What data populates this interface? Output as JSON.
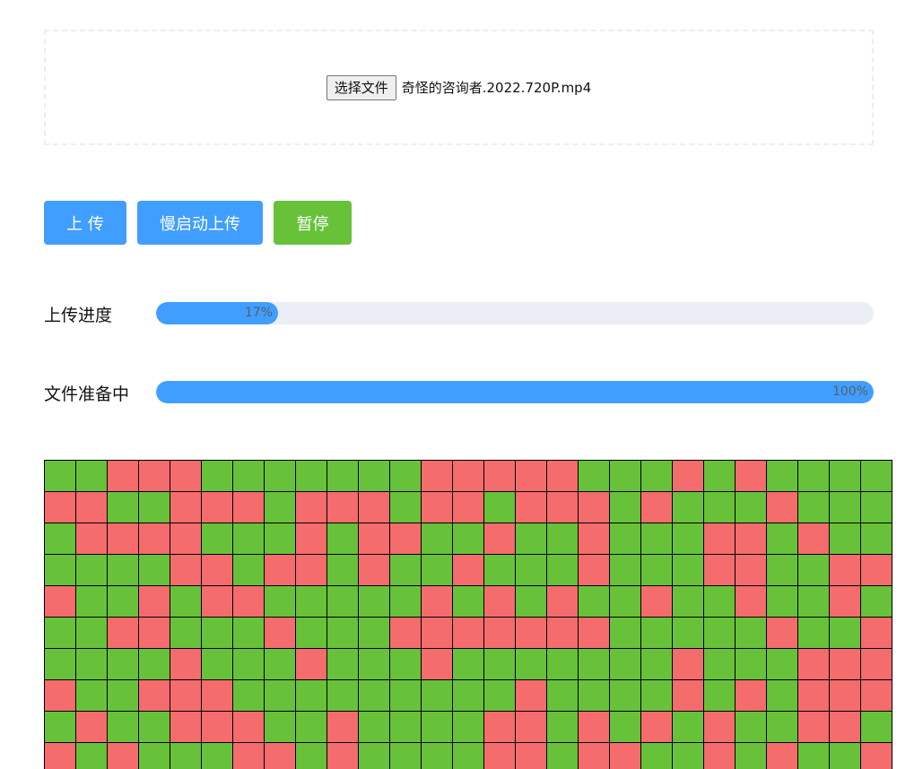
{
  "file_input": {
    "button_label": "选择文件",
    "file_name": "奇怪的咨询者.2022.720P.mp4"
  },
  "actions": {
    "upload_label": "上 传",
    "slow_start_upload_label": "慢启动上传",
    "pause_label": "暂停"
  },
  "progress": [
    {
      "label": "上传进度",
      "percent": 17,
      "text": "17%"
    },
    {
      "label": "文件准备中",
      "percent": 100,
      "text": "100%"
    }
  ],
  "colors": {
    "primary": "#409eff",
    "success": "#67c23a",
    "danger": "#f56c6c",
    "track": "#ebeef5"
  },
  "chunk_grid": {
    "columns": 27,
    "rows": [
      "GGRRRGGGGGGGRRRRRGGGRGRGGGG",
      "RRGGRRRGRRRGRRGRRRGRGGGRGGG",
      "GRRRRGGGRGRRGGRGGRGGGRRGRGG",
      "GGGGRRGRRGRGGRGGGRGGGRRGGRR",
      "RGGRGRRGGGGGRGRGRGGRGGRGGRG",
      "GGRRGGGRGGGRRRRRRRGGGGGRGGR",
      "GGGGRGGGRGGGRGGGGGGGRGGGRRR",
      "RGGRRRGGGGGGGGGRGGGGRGRGRRR",
      "GRGGRRRGGRGGGGRRGRGRGRGGRRG",
      "RGRGGGRRGRGGGGRRGRRGGRGRGGR"
    ]
  }
}
